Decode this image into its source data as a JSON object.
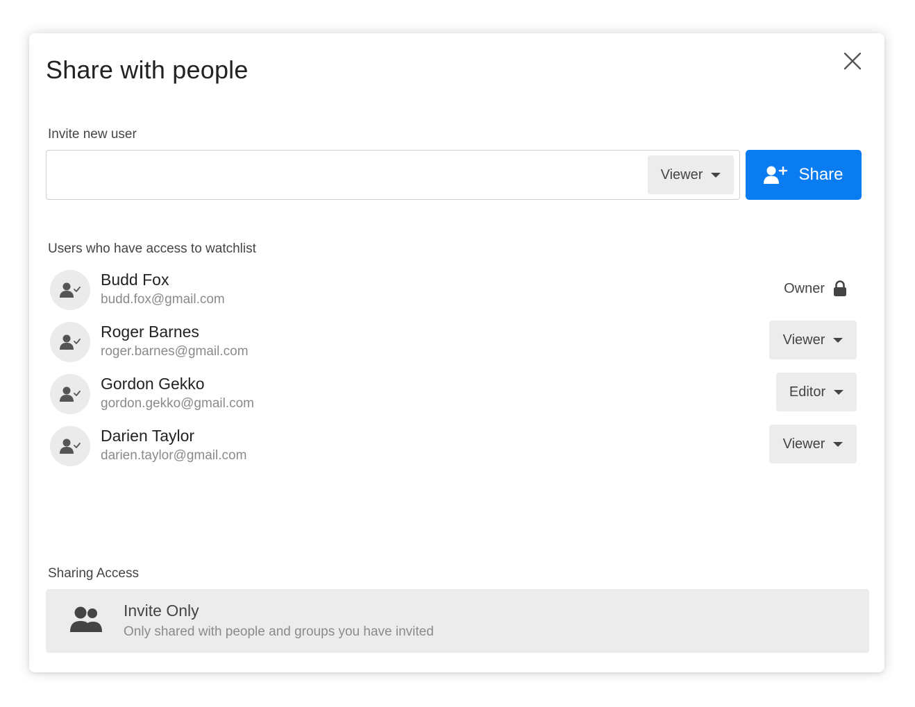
{
  "dialog": {
    "title": "Share with people"
  },
  "invite": {
    "label": "Invite new user",
    "input_value": "",
    "input_placeholder": "",
    "role": "Viewer",
    "share_label": "Share",
    "share_color": "#0a7cf1"
  },
  "users": {
    "label": "Users who have access to watchlist",
    "items": [
      {
        "name": "Budd Fox",
        "email": "budd.fox@gmail.com",
        "role": "Owner"
      },
      {
        "name": "Roger Barnes",
        "email": "roger.barnes@gmail.com",
        "role": "Viewer"
      },
      {
        "name": "Gordon Gekko",
        "email": "gordon.gekko@gmail.com",
        "role": "Editor"
      },
      {
        "name": "Darien Taylor",
        "email": "darien.taylor@gmail.com",
        "role": "Viewer"
      }
    ]
  },
  "sharing": {
    "label": "Sharing Access",
    "mode_title": "Invite Only",
    "mode_description": "Only shared with people and groups you have invited"
  },
  "icons": {
    "close": "close-icon",
    "add_user": "add-user-icon",
    "user_check": "user-check-icon",
    "lock": "lock-icon",
    "group": "group-icon",
    "caret": "caret-down-icon"
  }
}
